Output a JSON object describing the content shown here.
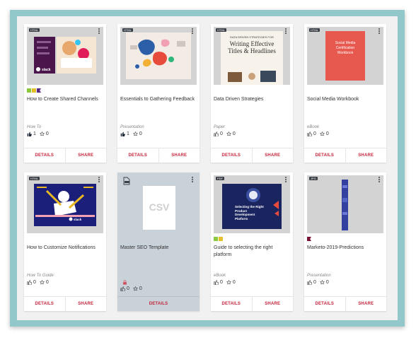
{
  "colors": {
    "frame": "#93c8cb",
    "panel": "#f1f1f1",
    "accent_red": "#c4243b",
    "tag_green": "#8dc63f",
    "tag_yellow": "#e5c02b",
    "tag_purple": "#5b2a86",
    "tag_maroon": "#7a1434"
  },
  "cards": [
    {
      "type": "HTML",
      "title": "How to Create Shared Channels",
      "category": "How To",
      "likes": "1",
      "favorites": "0",
      "tags": [
        "green",
        "yellow",
        "purple"
      ],
      "details_label": "DETAILS",
      "share_label": "SHARE"
    },
    {
      "type": "HTML",
      "title": "Essentials to Gathering Feedback",
      "category": "Presentation",
      "likes": "1",
      "favorites": "0",
      "details_label": "DETAILS",
      "share_label": "SHARE"
    },
    {
      "type": "HTML",
      "title": "Data Driven Strategies",
      "category": "Paper",
      "likes": "0",
      "favorites": "0",
      "thumb_text_1": "DATA DRIVEN STRATEGIES FOR",
      "thumb_text_2": "Writing Effective Titles & Headlines",
      "details_label": "DETAILS",
      "share_label": "SHARE"
    },
    {
      "type": "HTML",
      "title": "Social Media Workbook",
      "category": "eBook",
      "likes": "0",
      "favorites": "0",
      "thumb_text_1": "Social Media Certification Workbook",
      "details_label": "DETAILS",
      "share_label": "SHARE"
    },
    {
      "type": "HTML",
      "title": "How to Customize Notifications",
      "category": "How To Guide",
      "likes": "0",
      "favorites": "0",
      "details_label": "DETAILS",
      "share_label": "SHARE"
    },
    {
      "type": "CSV",
      "title": "Master SEO Template",
      "category": "",
      "likes": "0",
      "favorites": "0",
      "thumb_text_1": "CSV",
      "details_label": "DETAILS"
    },
    {
      "type": "PDF",
      "title": "Guide to selecting the right platform",
      "category": "eBook",
      "likes": "0",
      "favorites": "0",
      "tags": [
        "green",
        "yellow"
      ],
      "thumb_text_1": "Selecting the Right Product Development Platform",
      "details_label": "DETAILS",
      "share_label": "SHARE"
    },
    {
      "type": "JPG",
      "title": "Marketo-2019-Predictions",
      "category": "Presentation",
      "likes": "0",
      "favorites": "0",
      "tags": [
        "maroon"
      ],
      "details_label": "DETAILS",
      "share_label": "SHARE"
    }
  ]
}
